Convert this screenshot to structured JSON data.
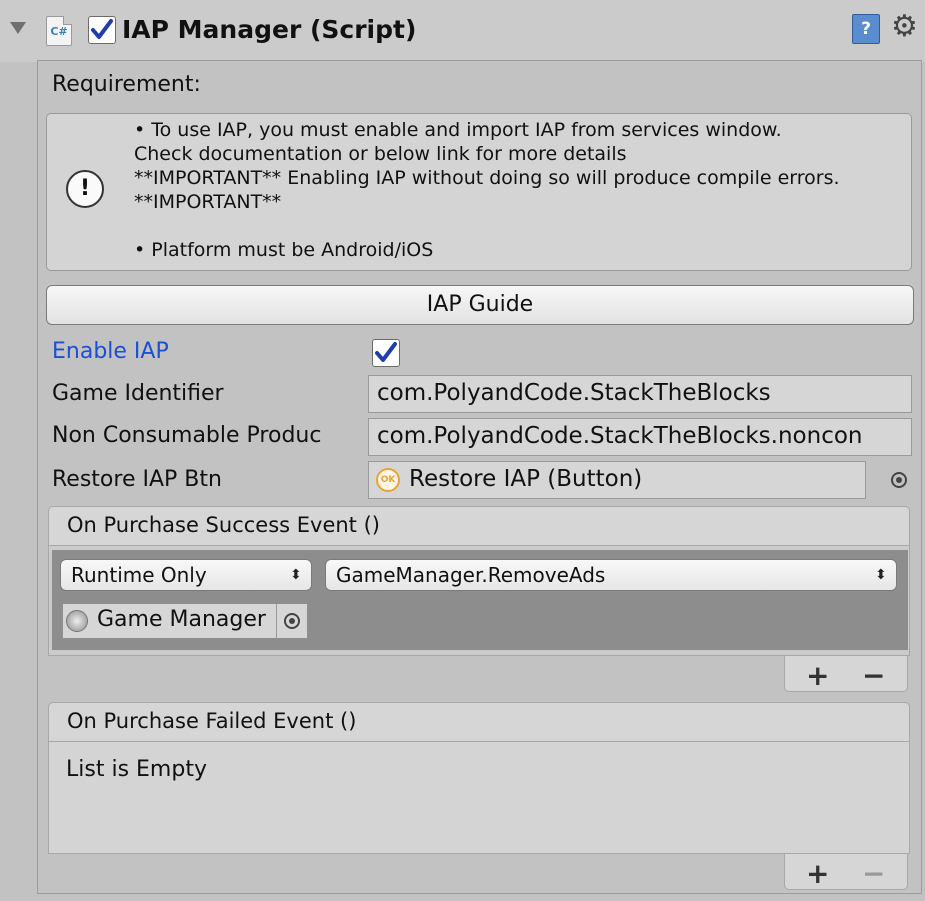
{
  "component": {
    "title": "IAP Manager (Script)",
    "script_icon_text": "C#",
    "help_icon_text": "?",
    "gear_icon_text": "⚙",
    "enabled": true
  },
  "requirement": {
    "label": "Requirement:",
    "help_text": "• To use IAP, you must enable and import IAP from services window.\nCheck documentation or below link for more details\n**IMPORTANT** Enabling IAP without doing so will produce compile errors. **IMPORTANT**\n\n• Platform must be Android/iOS",
    "info_icon_text": "!"
  },
  "guide_button": {
    "label": "IAP Guide"
  },
  "fields": {
    "enable_iap": {
      "label": "Enable IAP",
      "checked": true
    },
    "game_identifier": {
      "label": "Game Identifier",
      "value": "com.PolyandCode.StackTheBlocks"
    },
    "non_consumable": {
      "label": "Non Consumable Produc",
      "value": "com.PolyandCode.StackTheBlocks.noncon"
    },
    "restore_btn": {
      "label": "Restore IAP Btn",
      "value": "Restore IAP (Button)",
      "icon_text": "OK"
    }
  },
  "success_event": {
    "header": "On Purchase Success Event ()",
    "call_state": "Runtime Only",
    "method": "GameManager.RemoveAds",
    "target": "Game Manager",
    "popup_arrows": "⬍",
    "add": "+",
    "remove": "−"
  },
  "failed_event": {
    "header": "On Purchase Failed Event ()",
    "empty_text": "List is Empty",
    "add": "+",
    "remove": "−"
  }
}
